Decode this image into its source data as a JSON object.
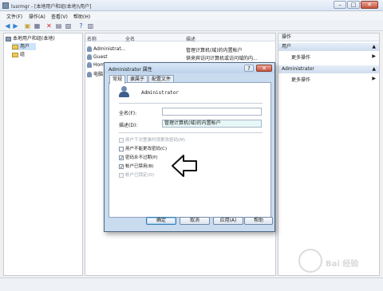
{
  "window": {
    "title": "lusrmgr - [本地用户和组(本地)\\用户]"
  },
  "menu": [
    "文件(F)",
    "操作(A)",
    "查看(V)",
    "帮助(H)"
  ],
  "tree": [
    {
      "label": "本地用户和组(本地)"
    },
    {
      "label": "用户"
    },
    {
      "label": "组"
    }
  ],
  "list": {
    "columns": [
      "名称",
      "全名",
      "描述"
    ],
    "rows": [
      {
        "name": "Administrat...",
        "fullname": "",
        "desc": "管理计算机(域)的内置帐户"
      },
      {
        "name": "Guest",
        "fullname": "",
        "desc": "供来宾访问计算机或访问域的内..."
      },
      {
        "name": "Home",
        "fullname": "",
        "desc": ""
      },
      {
        "name": "电脑",
        "fullname": "",
        "desc": ""
      }
    ]
  },
  "actions": {
    "header": "操作",
    "sections": [
      {
        "title": "用户",
        "item": "更多操作"
      },
      {
        "title": "Administrator",
        "item": "更多操作"
      }
    ]
  },
  "dialog": {
    "title": "Administrator 属性",
    "help": "?",
    "close": "✕",
    "tabs": [
      "常规",
      "隶属于",
      "配置文件"
    ],
    "username": "Administrator",
    "fullname_label": "全名(F):",
    "fullname_value": "",
    "desc_label": "描述(D):",
    "desc_value": "管理计算机(域)的内置帐户",
    "checkboxes": [
      {
        "label": "用户下次登录时须更改密码(M)",
        "checked": false,
        "disabled": true
      },
      {
        "label": "用户不能更改密码(C)",
        "checked": false,
        "disabled": false
      },
      {
        "label": "密码永不过期(P)",
        "checked": true,
        "disabled": false
      },
      {
        "label": "帐户已禁用(B)",
        "checked": true,
        "disabled": false
      },
      {
        "label": "帐户已锁定(O)",
        "checked": false,
        "disabled": true
      }
    ],
    "buttons": {
      "ok": "确定",
      "cancel": "取消",
      "apply": "应用(A)",
      "help": "帮助"
    }
  },
  "watermark": "Bai 经验"
}
